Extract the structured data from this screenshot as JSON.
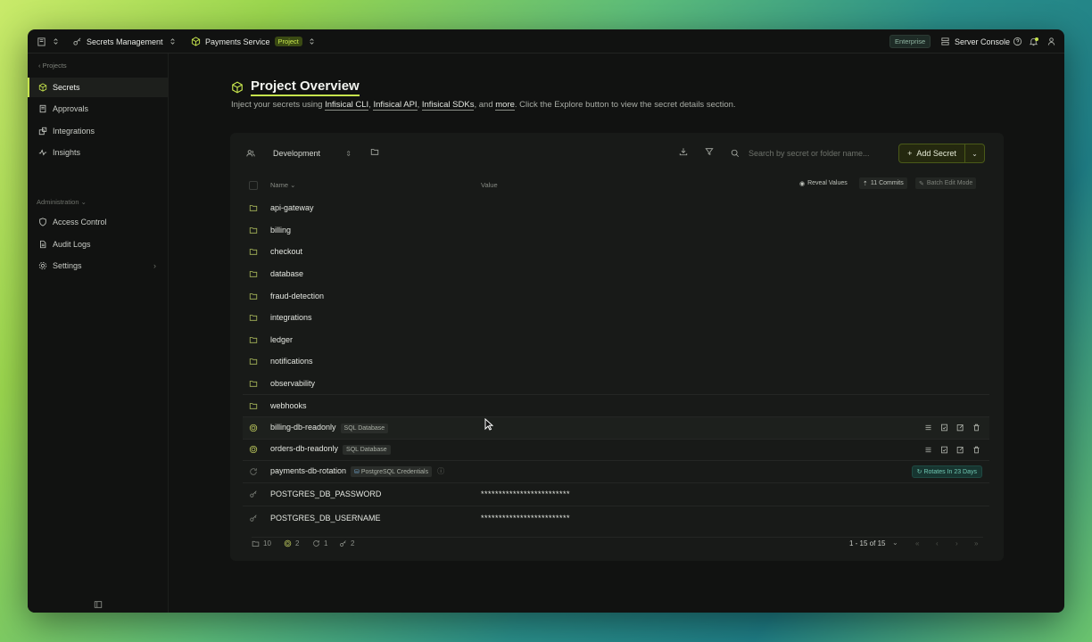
{
  "topbar": {
    "org": "Secrets Management",
    "project": "Payments Service",
    "project_badge": "Project",
    "enterprise": "Enterprise",
    "server_console": "Server Console"
  },
  "sidebar": {
    "back": "Projects",
    "items": [
      {
        "label": "Secrets",
        "icon": "cube-icon"
      },
      {
        "label": "Approvals",
        "icon": "document-icon"
      },
      {
        "label": "Integrations",
        "icon": "puzzle-icon"
      },
      {
        "label": "Insights",
        "icon": "activity-icon"
      }
    ],
    "section": "Administration",
    "admin_items": [
      {
        "label": "Access Control",
        "icon": "shield-icon"
      },
      {
        "label": "Audit Logs",
        "icon": "file-icon"
      },
      {
        "label": "Settings",
        "icon": "gear-icon"
      }
    ]
  },
  "main": {
    "title": "Project Overview",
    "subtitle_pre": "Inject your secrets using ",
    "link1": "Infisical CLI",
    "link2": "Infisical API",
    "link3": "Infisical SDKs",
    "and": ", and ",
    "link4": "more",
    "subtitle_post": ". Click the Explore button to view the secret details section.",
    "comma": ", "
  },
  "toolbar": {
    "environment": "Development",
    "search_placeholder": "Search by secret or folder name...",
    "add_label": "Add Secret"
  },
  "table": {
    "col_name": "Name",
    "col_value": "Value",
    "reveal": "Reveal Values",
    "commits": "11 Commits",
    "batch": "Batch Edit Mode",
    "folders": [
      "api-gateway",
      "billing",
      "checkout",
      "database",
      "fraud-detection",
      "integrations",
      "ledger",
      "notifications",
      "observability",
      "webhooks"
    ],
    "dynamic": [
      {
        "name": "billing-db-readonly",
        "tag": "SQL Database"
      },
      {
        "name": "orders-db-readonly",
        "tag": "SQL Database"
      }
    ],
    "rotation": {
      "name": "payments-db-rotation",
      "tag": "PostgreSQL Credentials",
      "status": "Rotates In 23 Days"
    },
    "secrets": [
      {
        "name": "POSTGRES_DB_PASSWORD",
        "value": "*************************"
      },
      {
        "name": "POSTGRES_DB_USERNAME",
        "value": "*************************"
      }
    ]
  },
  "footer": {
    "folders": "10",
    "dynamic": "2",
    "rotations": "1",
    "secrets": "2",
    "pagination": "1 - 15 of 15"
  },
  "colors": {
    "accent": "#c6e44d",
    "background": "#111211",
    "panel": "#181a18"
  }
}
